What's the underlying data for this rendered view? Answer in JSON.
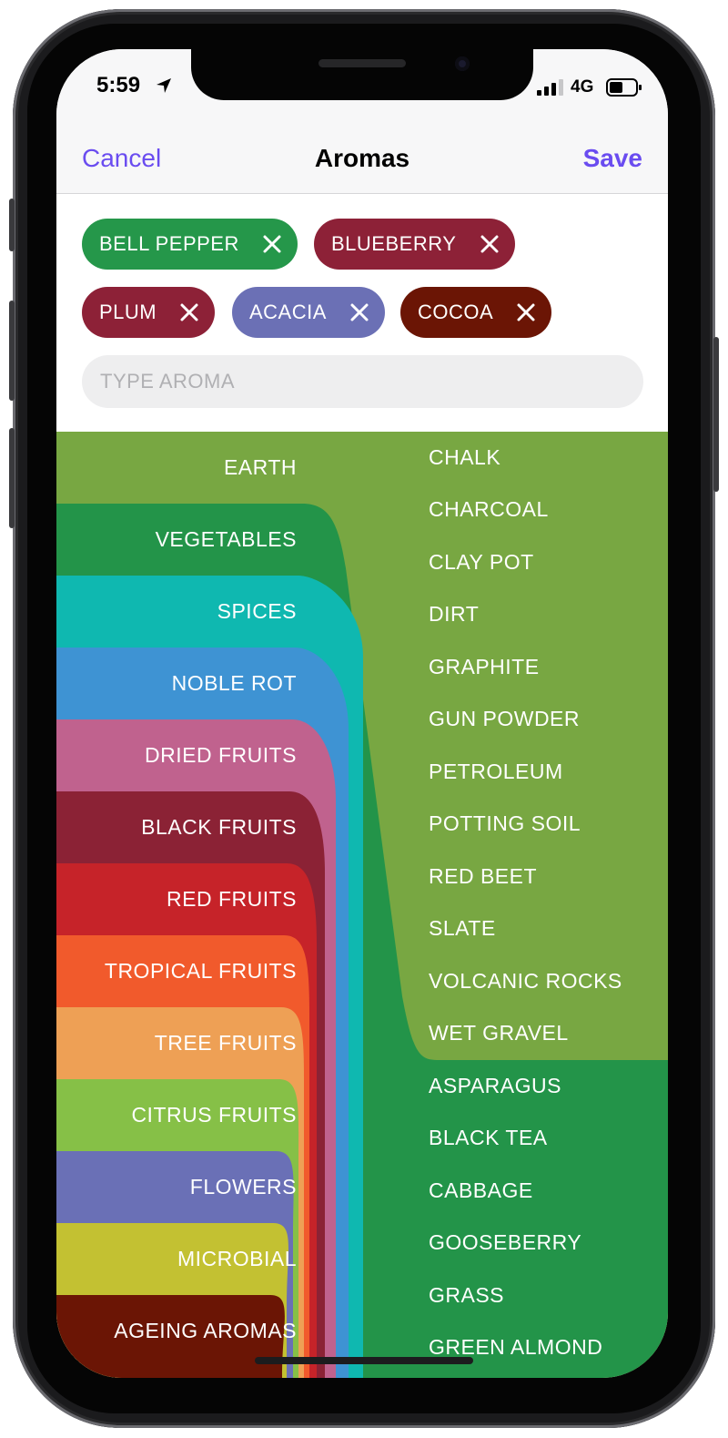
{
  "status_bar": {
    "time": "5:59",
    "network": "4G"
  },
  "nav": {
    "cancel": "Cancel",
    "title": "Aromas",
    "save": "Save"
  },
  "selected_tags": [
    {
      "label": "BELL PEPPER",
      "color": "#25974a"
    },
    {
      "label": "BLUEBERRY",
      "color": "#8d2137"
    },
    {
      "label": "PLUM",
      "color": "#8d2137"
    },
    {
      "label": "ACACIA",
      "color": "#6b70b5"
    },
    {
      "label": "COCOA",
      "color": "#6b1505"
    }
  ],
  "search": {
    "placeholder": "TYPE AROMA"
  },
  "categories": [
    {
      "label": "EARTH",
      "color": "#78a742"
    },
    {
      "label": "VEGETABLES",
      "color": "#239449"
    },
    {
      "label": "SPICES",
      "color": "#0fb8b0"
    },
    {
      "label": "NOBLE ROT",
      "color": "#3e93d3"
    },
    {
      "label": "DRIED FRUITS",
      "color": "#c0628e"
    },
    {
      "label": "BLACK FRUITS",
      "color": "#8b2235"
    },
    {
      "label": "RED FRUITS",
      "color": "#c62329"
    },
    {
      "label": "TROPICAL FRUITS",
      "color": "#f15a2c"
    },
    {
      "label": "TREE FRUITS",
      "color": "#eea055"
    },
    {
      "label": "CITRUS FRUITS",
      "color": "#86c047"
    },
    {
      "label": "FLOWERS",
      "color": "#6a70b6"
    },
    {
      "label": "MICROBIAL",
      "color": "#c3c132"
    },
    {
      "label": "AGEING AROMAS",
      "color": "#6b1505"
    }
  ],
  "subcategories": {
    "earth": [
      "CHALK",
      "CHARCOAL",
      "CLAY POT",
      "DIRT",
      "GRAPHITE",
      "GUN POWDER",
      "PETROLEUM",
      "POTTING SOIL",
      "RED BEET",
      "SLATE",
      "VOLCANIC ROCKS",
      "WET GRAVEL"
    ],
    "vegetables": [
      "ASPARAGUS",
      "BLACK TEA",
      "CABBAGE",
      "GOOSEBERRY",
      "GRASS",
      "GREEN ALMOND"
    ]
  }
}
